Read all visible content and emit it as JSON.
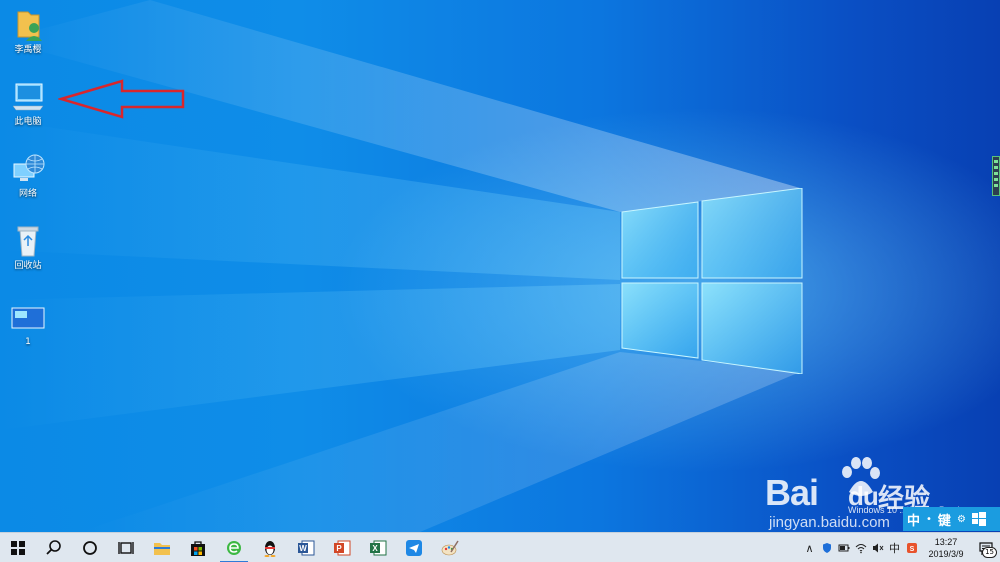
{
  "desktop": {
    "icons": [
      {
        "label": "李禹樱",
        "icon": "user-folder-icon"
      },
      {
        "label": "此电脑",
        "icon": "computer-icon"
      },
      {
        "label": "网络",
        "icon": "network-icon"
      },
      {
        "label": "回收站",
        "icon": "recycle-bin-icon"
      },
      {
        "label": "1",
        "icon": "image-file-icon"
      }
    ],
    "annotation": "red-arrow-pointing-left",
    "watermark": {
      "brand": "Bai",
      "brand_suffix": "du",
      "cn": "经验",
      "url": "jingyan.baidu.com"
    },
    "build_info": "Windows 10 ... Insider Preview",
    "ime": {
      "mode": "中",
      "dot": "•",
      "key": "键",
      "extra": "⚙"
    }
  },
  "taskbar": {
    "apps": [
      {
        "name": "start-button",
        "icon": "windows-icon"
      },
      {
        "name": "search-button",
        "icon": "search-icon"
      },
      {
        "name": "cortana-button",
        "icon": "circle-icon"
      },
      {
        "name": "task-view-button",
        "icon": "task-view-icon"
      },
      {
        "name": "file-explorer-button",
        "icon": "folder-icon"
      },
      {
        "name": "store-button",
        "icon": "store-bag-icon"
      },
      {
        "name": "browser-button",
        "icon": "browser-e-icon"
      },
      {
        "name": "qq-button",
        "icon": "penguin-icon"
      },
      {
        "name": "word-button",
        "icon": "word-icon",
        "letter": "W"
      },
      {
        "name": "powerpoint-button",
        "icon": "powerpoint-icon",
        "letter": "P"
      },
      {
        "name": "excel-button",
        "icon": "excel-icon",
        "letter": "X"
      },
      {
        "name": "feishu-button",
        "icon": "paper-plane-icon"
      },
      {
        "name": "paint-button",
        "icon": "paint-palette-icon"
      }
    ],
    "tray": {
      "chevron": "∧",
      "ime_char": "中",
      "time": "13:27",
      "date": "2019/3/9",
      "notification_count": "15"
    }
  },
  "colors": {
    "desktop_blue": "#0a63d6",
    "taskbar": "#dfe7ef",
    "arrow": "#d9262c",
    "accent": "#2f7bd8"
  }
}
